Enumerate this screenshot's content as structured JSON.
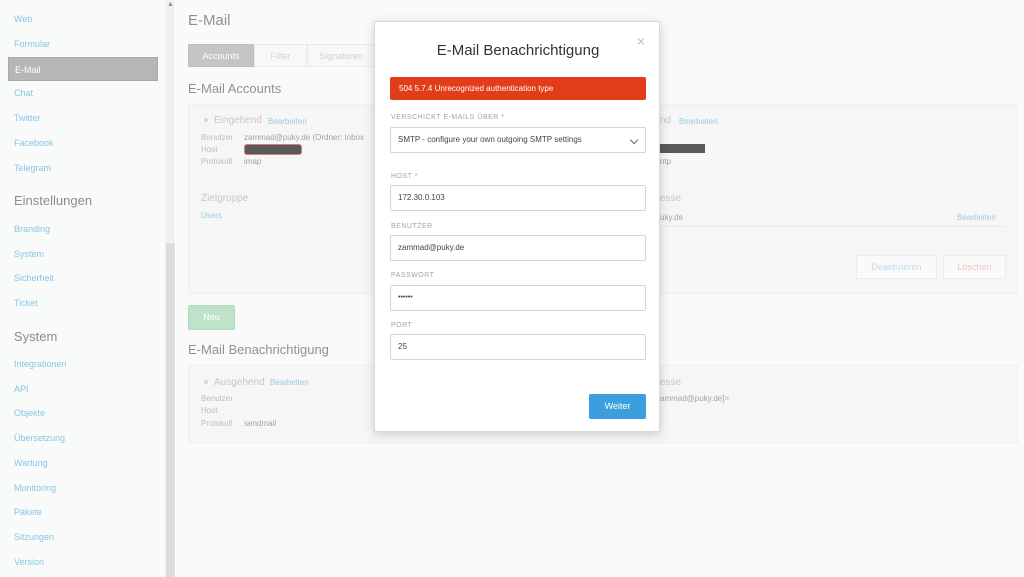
{
  "sidebar": {
    "channels": [
      "Web",
      "Formular",
      "E-Mail",
      "Chat",
      "Twitter",
      "Facebook",
      "Telegram"
    ],
    "settings_heading": "Einstellungen",
    "settings": [
      "Branding",
      "System",
      "Sicherheit",
      "Ticket"
    ],
    "system_heading": "System",
    "system": [
      "Integrationen",
      "API",
      "Objekte",
      "Übersetzung",
      "Wartung",
      "Monitoring",
      "Pakete",
      "Sitzungen",
      "Version"
    ]
  },
  "main": {
    "title": "E-Mail",
    "tabs": [
      "Accounts",
      "Filter",
      "Signaturen"
    ],
    "accounts_heading": "E-Mail Accounts",
    "inbound": {
      "heading": "Eingehend",
      "edit": "Bearbeiten",
      "user_label": "Benutzer",
      "user_value": "zammad@puky.de (Ordner: Inbox",
      "host_label": "Host",
      "protocol_label": "Protokoll",
      "protocol_value": "imap"
    },
    "outbound": {
      "heading_tail": "nd",
      "edit": "Bearbeiten",
      "protocol_tail": "ntp"
    },
    "group": {
      "heading": "Zielgruppe",
      "value": "Users"
    },
    "address": {
      "heading_tail": "esse",
      "value_tail": "uky.de",
      "edit": "Bearbeiten"
    },
    "deactivate": "Deaktivieren",
    "delete": "Löschen",
    "new_button": "Neu",
    "notification_heading": "E-Mail Benachrichtigung",
    "notif": {
      "heading": "Ausgehend",
      "edit": "Bearbeiten",
      "user_label": "Benutzer",
      "host_label": "Host",
      "protocol_label": "Protokoll",
      "protocol_value": "sendmail",
      "address_heading_tail": "esse",
      "address_value_tail": "ammad@puky.de]>"
    }
  },
  "modal": {
    "title": "E-Mail Benachrichtigung",
    "close": "×",
    "error": "504 5.7.4 Unrecognized authentication type",
    "via_label": "VERSCHICKT E-MAILS ÜBER *",
    "via_value": "SMTP - configure your own outgoing SMTP settings",
    "host_label": "HOST *",
    "host_value": "172.30.0.103",
    "user_label": "BENUTZER",
    "user_value": "zammad@puky.de",
    "password_label": "PASSWORT",
    "password_value": "••••••",
    "port_label": "PORT",
    "port_value": "25",
    "submit": "Weiter"
  },
  "colors": {
    "error": "#e23c18",
    "primary": "#3a9fdc",
    "success": "#9cd5ae",
    "link": "#46a8d8"
  }
}
